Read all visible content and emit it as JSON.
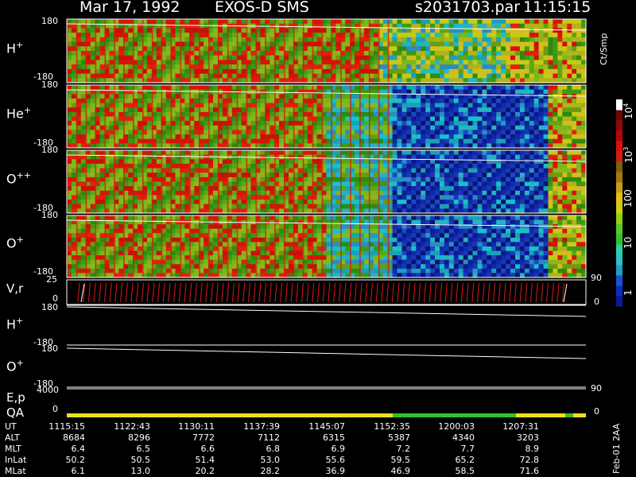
{
  "header": {
    "date": "Mar 17, 1992",
    "instrument": "EXOS-D SMS",
    "file": "s2031703.par",
    "time": "11:15:15"
  },
  "side_label": "Feb-01 2AA",
  "chart_data": [
    {
      "type": "heatmap",
      "title": "",
      "panels": [
        {
          "species": "H",
          "charge": "+",
          "ylim": [
            -180,
            180
          ]
        },
        {
          "species": "He",
          "charge": "+",
          "ylim": [
            -180,
            180
          ]
        },
        {
          "species": "O",
          "charge": "++",
          "ylim": [
            -180,
            180
          ]
        },
        {
          "species": "O",
          "charge": "+",
          "ylim": [
            -180,
            180
          ]
        }
      ],
      "colorbar": {
        "unit": "Ct/Smp",
        "scale": "log",
        "range": [
          1,
          10000
        ],
        "ticks": [
          {
            "value": 1,
            "label": "1"
          },
          {
            "value": 10,
            "label": "10"
          },
          {
            "value": 100,
            "label": "100"
          },
          {
            "value": 1000,
            "label": "10",
            "sup": "3"
          },
          {
            "value": 10000,
            "label": "10",
            "sup": "4"
          }
        ]
      }
    },
    {
      "type": "line",
      "label": "V,r",
      "yticks_left": [
        "25",
        "0"
      ],
      "yticks_right": [
        "90",
        "0"
      ]
    },
    {
      "type": "line",
      "series": [
        {
          "species": "H",
          "charge": "+",
          "ylim": [
            -180,
            180
          ]
        },
        {
          "species": "O",
          "charge": "+",
          "ylim": [
            -180,
            180
          ]
        }
      ]
    },
    {
      "type": "line",
      "label_top": "E,p",
      "label_bottom": "QA",
      "yticks_left": [
        "4000",
        "0"
      ],
      "yticks_right": [
        "90",
        "0"
      ]
    }
  ],
  "ephemeris": {
    "rows": [
      {
        "label": "UT",
        "values": [
          "1115:15",
          "1122:43",
          "1130:11",
          "1137:39",
          "1145:07",
          "1152:35",
          "1200:03",
          "1207:31"
        ]
      },
      {
        "label": "ALT",
        "values": [
          "8684",
          "8296",
          "7772",
          "7112",
          "6315",
          "5387",
          "4340",
          "3203"
        ]
      },
      {
        "label": "MLT",
        "values": [
          "6.4",
          "6.5",
          "6.6",
          "6.8",
          "6.9",
          "7.2",
          "7.7",
          "8.9"
        ]
      },
      {
        "label": "InLat",
        "values": [
          "50.2",
          "50.5",
          "51.4",
          "53.0",
          "55.6",
          "59.5",
          "65.2",
          "72.8"
        ]
      },
      {
        "label": "MLat",
        "values": [
          "6.1",
          "13.0",
          "20.2",
          "28.2",
          "36.9",
          "46.9",
          "58.5",
          "71.6"
        ]
      }
    ]
  },
  "colors": {
    "background": "#000000",
    "text": "#ffffff",
    "qa_good": "#f0e020",
    "qa_green": "#30c030",
    "trace": "#ffffff"
  }
}
